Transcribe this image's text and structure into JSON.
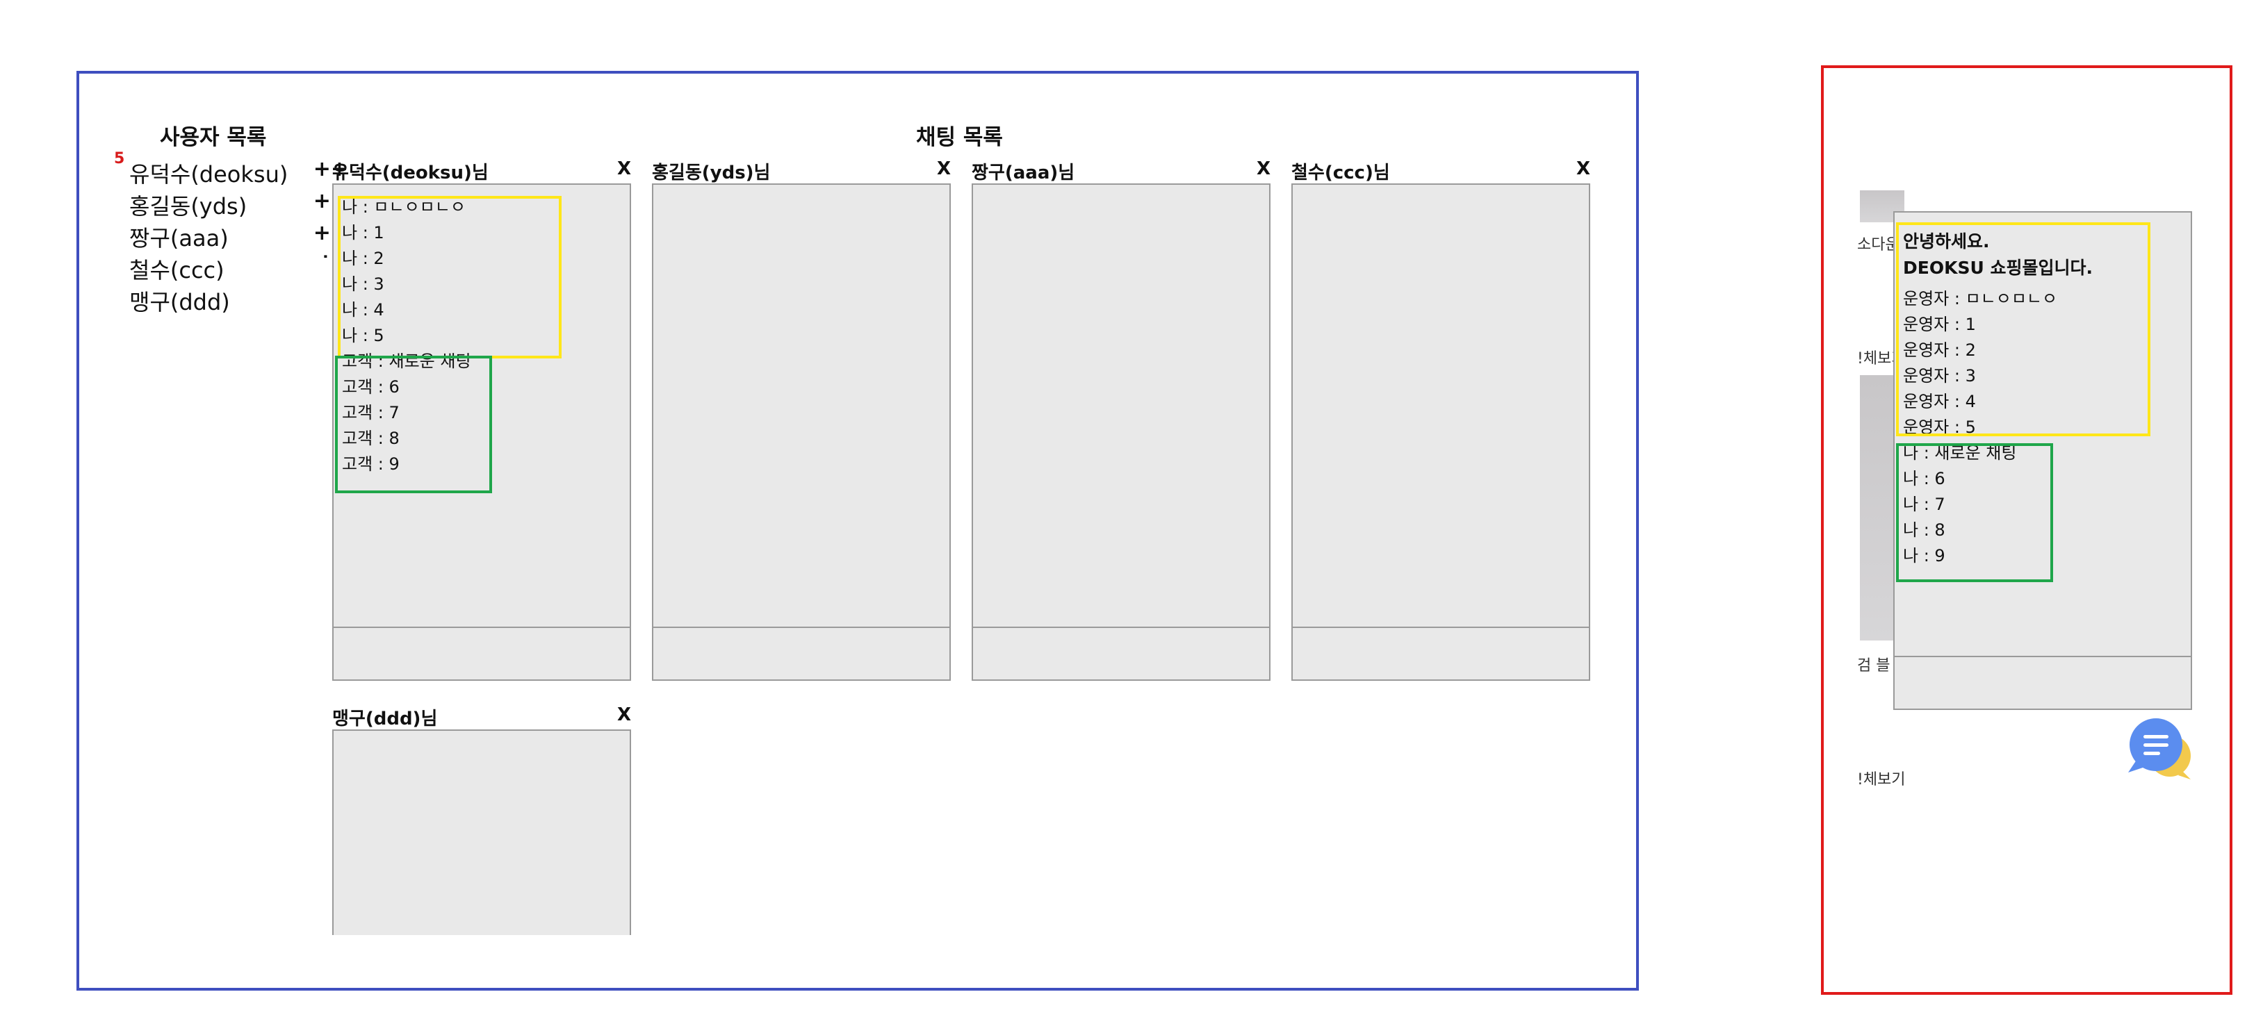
{
  "admin": {
    "user_list_title": "사용자 목록",
    "chat_list_title": "채팅 목록",
    "users": [
      {
        "badge": "5",
        "name": "유덕수(deoksu)",
        "mark": "++"
      },
      {
        "badge": "",
        "name": "홍길동(yds)",
        "mark": "++"
      },
      {
        "badge": "",
        "name": "짱구(aaa)",
        "mark": "++"
      },
      {
        "badge": "",
        "name": "철수(ccc)",
        "mark": "˙+"
      },
      {
        "badge": "",
        "name": "맹구(ddd)",
        "mark": "+"
      }
    ],
    "rooms": [
      {
        "title": "유덕수(deoksu)님",
        "close": "X",
        "messages": [
          "나 : ㅁㄴㅇㅁㄴㅇ",
          "나 : 1",
          "나 : 2",
          "나 : 3",
          "나 : 4",
          "나 : 5",
          "고객 : 새로운 채팅",
          "고객 : 6",
          "고객 : 7",
          "고객 : 8",
          "고객 : 9"
        ]
      },
      {
        "title": "홍길동(yds)님",
        "close": "X",
        "messages": []
      },
      {
        "title": "짱구(aaa)님",
        "close": "X",
        "messages": []
      },
      {
        "title": "철수(ccc)님",
        "close": "X",
        "messages": []
      },
      {
        "title": "맹구(ddd)님",
        "close": "X",
        "messages": []
      }
    ],
    "highlight_colors": {
      "sent": "#ffe619",
      "received": "#1fa64a"
    },
    "panel_border_color": "#3f4fbf"
  },
  "customer": {
    "panel_border_color": "#e01a1a",
    "background_fragments": [
      "소다운",
      "!체보기",
      "검 블",
      "!체보기"
    ],
    "greeting_line1": "안녕하세요.",
    "greeting_line2": "DEOKSU 쇼핑몰입니다.",
    "messages": [
      "운영자 : ㅁㄴㅇㅁㄴㅇ",
      "운영자 : 1",
      "운영자 : 2",
      "운영자 : 3",
      "운영자 : 4",
      "운영자 : 5",
      "나 : 새로운 채팅",
      "나 : 6",
      "나 : 7",
      "나 : 8",
      "나 : 9"
    ],
    "chat_fab_icon": "chat-bubbles-icon",
    "chat_fab_colors": {
      "front": "#5b8def",
      "back": "#f2c94c"
    }
  }
}
